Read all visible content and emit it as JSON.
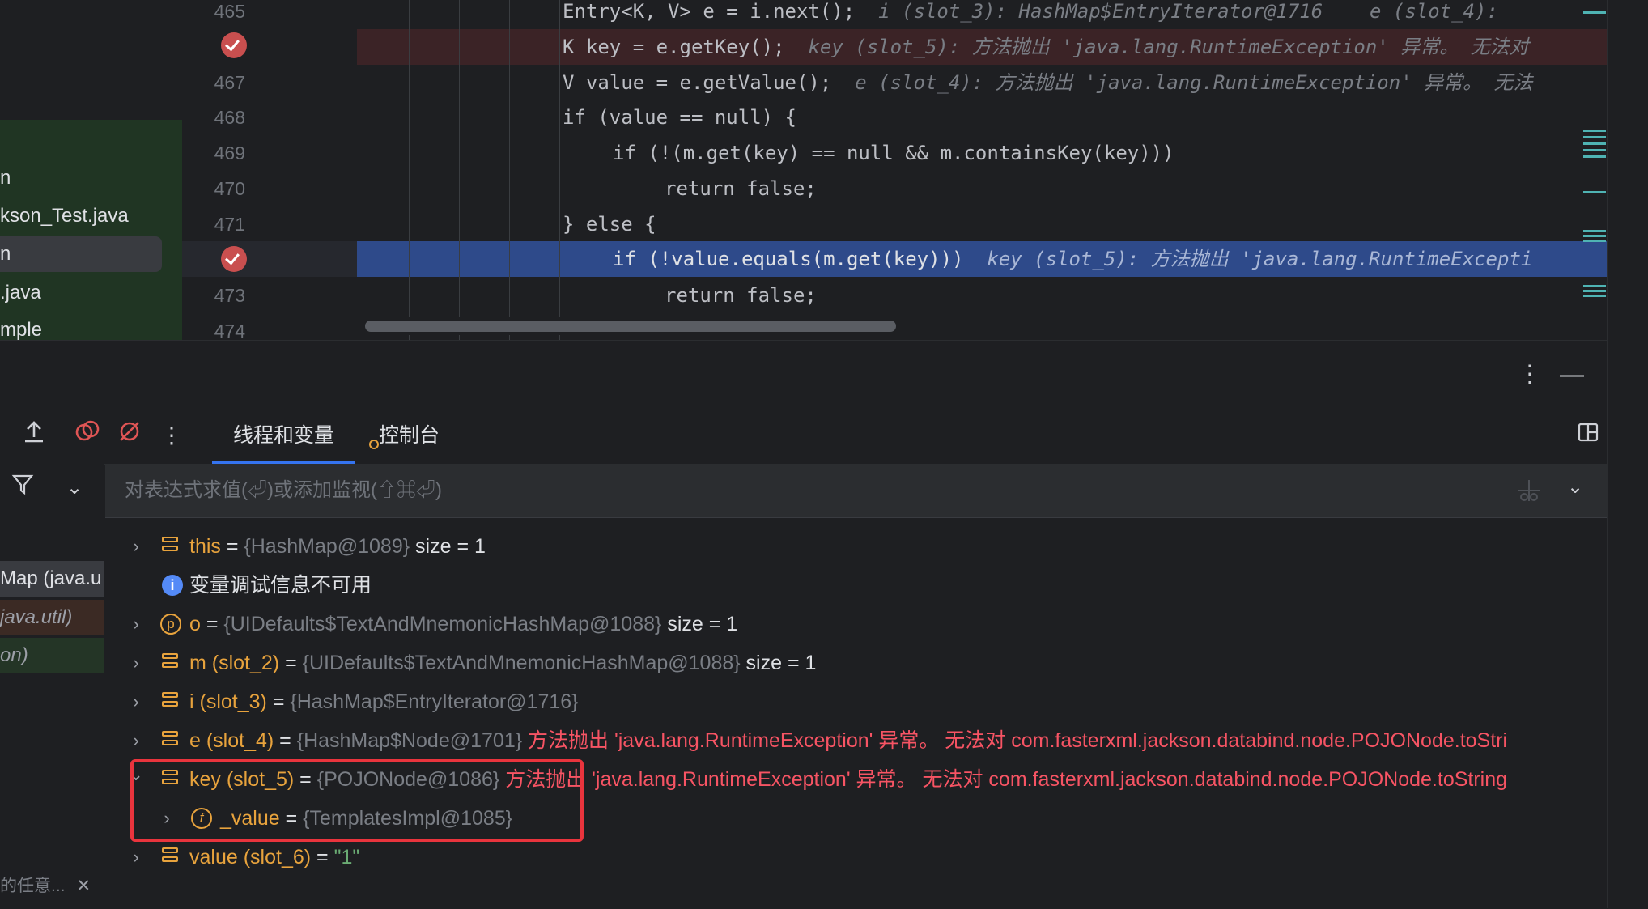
{
  "project": {
    "items": [
      {
        "label": "n",
        "selected": false
      },
      {
        "label": "kson_Test.java",
        "selected": false
      },
      {
        "label": "n",
        "selected": true
      },
      {
        "label": ".java",
        "selected": false
      },
      {
        "label": "mple",
        "selected": false
      }
    ]
  },
  "editor": {
    "line_numbers": [
      "465",
      "",
      "467",
      "468",
      "469",
      "470",
      "471",
      "",
      "473",
      "474"
    ],
    "lines": {
      "l465_code": "Entry<K, V> e = i.next();",
      "l465_hint": "  i (slot_3): HashMap$EntryIterator@1716    e (slot_4): ",
      "l466_code": "K key = e.getKey();",
      "l466_hint": "  key (slot_5): 方法抛出 'java.lang.RuntimeException' 异常。 无法对",
      "l467_code": "V value = e.getValue();",
      "l467_hint": "  e (slot_4): 方法抛出 'java.lang.RuntimeException' 异常。 无法",
      "l468_code": "if (value == null) {",
      "l469_code": "if (!(m.get(key) == null && m.containsKey(key)))",
      "l470_code": "return false;",
      "l471_code": "} else {",
      "l472_code": "if (!value.equals(m.get(key)))",
      "l472_hint": "  key (slot_5): 方法抛出 'java.lang.RuntimeExcepti",
      "l473_code": "return false;"
    }
  },
  "debug": {
    "tabs": [
      {
        "label": "线程和变量",
        "active": true
      },
      {
        "label": "控制台",
        "active": false
      }
    ],
    "eval_placeholder": "对表达式求值(⏎)或添加监视(⇧⌘⏎)",
    "frames": [
      {
        "label": "Map (java.u",
        "color": "#dfe1e5"
      },
      {
        "label": "java.util)",
        "color": "#9da0a8"
      },
      {
        "label": "on)",
        "color": "#9da0a8"
      }
    ],
    "footer_hint": "的任意...",
    "variables": [
      {
        "expand": "›",
        "icon": "field",
        "name": "this",
        "eq": " = ",
        "type": "{HashMap@1089}",
        "extra": "  size = 1",
        "err": ""
      },
      {
        "expand": "",
        "icon": "info",
        "name": "变量调试信息不可用",
        "eq": "",
        "type": "",
        "extra": "",
        "err": ""
      },
      {
        "expand": "›",
        "icon": "param",
        "name": "o",
        "eq": " = ",
        "type": "{UIDefaults$TextAndMnemonicHashMap@1088}",
        "extra": "  size = 1",
        "err": ""
      },
      {
        "expand": "›",
        "icon": "field",
        "name": "m (slot_2)",
        "eq": " = ",
        "type": "{UIDefaults$TextAndMnemonicHashMap@1088}",
        "extra": "  size = 1",
        "err": ""
      },
      {
        "expand": "›",
        "icon": "field",
        "name": "i (slot_3)",
        "eq": " = ",
        "type": "{HashMap$EntryIterator@1716}",
        "extra": "",
        "err": ""
      },
      {
        "expand": "›",
        "icon": "field",
        "name": "e (slot_4)",
        "eq": " = ",
        "type": "{HashMap$Node@1701}",
        "extra": "",
        "err": " 方法抛出 'java.lang.RuntimeException' 异常。 无法对 com.fasterxml.jackson.databind.node.POJONode.toStri"
      },
      {
        "expand": "⌄",
        "icon": "field",
        "name": "key (slot_5)",
        "eq": " = ",
        "type": "{POJONode@1086}",
        "extra": "",
        "err": " 方法抛出 'java.lang.RuntimeException' 异常。 无法对 com.fasterxml.jackson.databind.node.POJONode.toString"
      },
      {
        "expand": "›",
        "icon": "f-field",
        "name": "_value",
        "eq": " = ",
        "type": "{TemplatesImpl@1085}",
        "extra": "",
        "err": ""
      },
      {
        "expand": "›",
        "icon": "field",
        "name": "value (slot_6)",
        "eq": " = ",
        "type": "\"1\"",
        "extra": "",
        "err": ""
      }
    ]
  },
  "colors": {
    "accent": "#3574f0",
    "highlight_box": "#e9343d",
    "breakpoint": "#c94f4f"
  }
}
